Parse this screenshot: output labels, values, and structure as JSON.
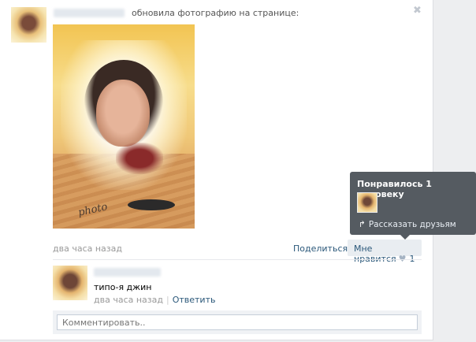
{
  "post": {
    "action_text": "обновила фотографию на странице:",
    "time": "два часа назад",
    "share_label": "Поделиться",
    "like_label": "Мне нравится",
    "like_count": "1",
    "close_glyph": "✖",
    "share_icon": "megaphone-icon",
    "like_icon": "heart-icon",
    "photo_caption": "photo"
  },
  "comment": {
    "text": "типо-я джин",
    "time": "два часа назад",
    "separator": "|",
    "reply_label": "Ответить"
  },
  "comment_box": {
    "placeholder": "Комментировать.."
  },
  "tooltip": {
    "title": "Понравилось 1 человеку",
    "share_to_friends": "Рассказать друзьям"
  },
  "colors": {
    "link": "#2b587a",
    "muted": "#999999",
    "tooltip_bg": "#555b61"
  }
}
